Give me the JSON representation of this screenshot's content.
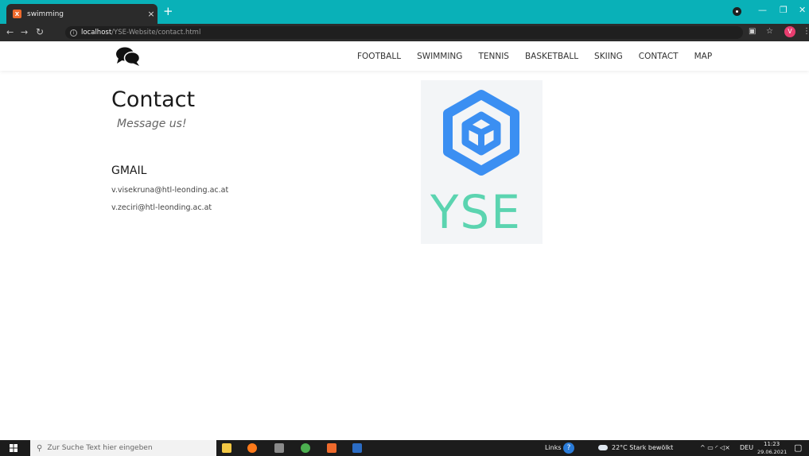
{
  "browser": {
    "tab_title": "swimming",
    "tab_close": "×",
    "new_tab": "+",
    "url_host": "localhost",
    "url_path": "/YSE-Website/contact.html",
    "profile_initial": "V"
  },
  "nav": {
    "items": [
      "FOOTBALL",
      "SWIMMING",
      "TENNIS",
      "BASKETBALL",
      "SKIING",
      "CONTACT",
      "MAP"
    ]
  },
  "contact": {
    "title": "Contact",
    "subtitle": "Message us!",
    "section_heading": "GMAIL",
    "emails": [
      "v.visekruna@htl-leonding.ac.at",
      "v.zeciri@htl-leonding.ac.at"
    ]
  },
  "brand": {
    "logo_text": "YSE",
    "hex_color": "#3b8ff2",
    "text_color": "#5bd4b0"
  },
  "taskbar": {
    "search_placeholder": "Zur Suche Text hier eingeben",
    "links_label": "Links",
    "weather": "22°C  Stark bewölkt",
    "language": "DEU",
    "time": "11:23",
    "date": "29.06.2021"
  },
  "icons": [
    "chat-bubbles-icon",
    "search-icon",
    "windows-icon",
    "reload-icon",
    "back-icon",
    "forward-icon",
    "star-icon"
  ]
}
